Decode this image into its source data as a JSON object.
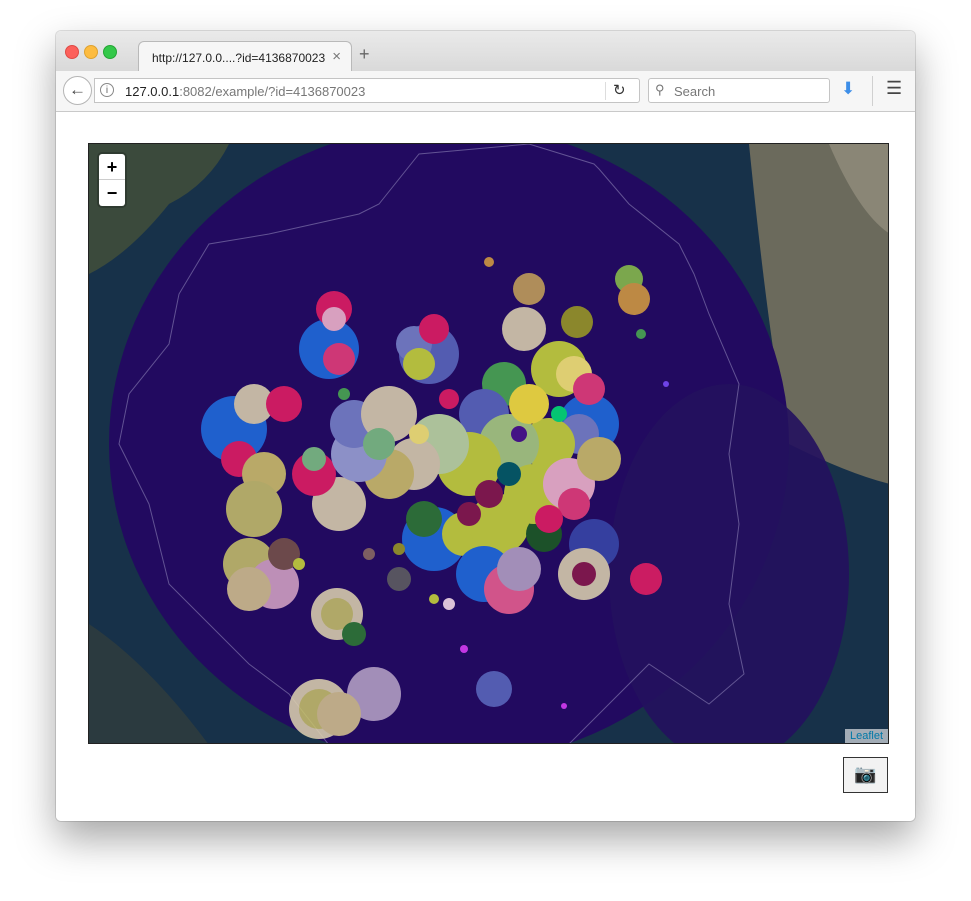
{
  "browser": {
    "tab_title": "http://127.0.0....?id=4136870023",
    "tab_close": "×",
    "new_tab": "+",
    "url_host": "127.0.0.1",
    "url_rest": ":8082/example/?id=4136870023",
    "search_placeholder": "Search"
  },
  "map": {
    "zoom_in": "+",
    "zoom_out": "−",
    "attribution": "Leaflet",
    "colors": {
      "sea": "#173149",
      "blob": "#220a60",
      "land": "#5a6a5c"
    }
  },
  "screenshot_button": {
    "icon": "camera-icon",
    "glyph": "📷"
  }
}
